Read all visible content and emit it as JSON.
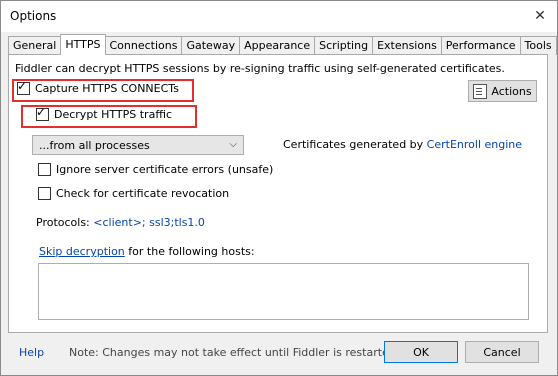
{
  "window": {
    "title": "Options",
    "close_glyph": "✕"
  },
  "tabs": [
    {
      "label": "General"
    },
    {
      "label": "HTTPS"
    },
    {
      "label": "Connections"
    },
    {
      "label": "Gateway"
    },
    {
      "label": "Appearance"
    },
    {
      "label": "Scripting"
    },
    {
      "label": "Extensions"
    },
    {
      "label": "Performance"
    },
    {
      "label": "Tools"
    }
  ],
  "https": {
    "intro": "Fiddler can decrypt HTTPS sessions by re-signing traffic using self-generated certificates.",
    "capture_label": "Capture HTTPS CONNECTs",
    "capture_checked": true,
    "decrypt_label": "Decrypt HTTPS traffic",
    "decrypt_checked": true,
    "actions_label": "Actions",
    "process_filter": "...from all processes",
    "cert_text": "Certificates generated by",
    "cert_engine": "CertEnroll engine",
    "ignore_errors_label": "Ignore server certificate errors (unsafe)",
    "ignore_errors_checked": false,
    "revocation_label": "Check for certificate revocation",
    "revocation_checked": false,
    "protocols_label": "Protocols:",
    "protocols_value": "<client>; ssl3;tls1.0",
    "skip_link": "Skip decryption",
    "skip_text": "for the following hosts:",
    "skip_hosts": ""
  },
  "footer": {
    "help": "Help",
    "note": "Note: Changes may not take effect until Fiddler is restarted.",
    "ok": "OK",
    "cancel": "Cancel"
  },
  "colors": {
    "highlight_box": "#e03030",
    "link": "#0645ad"
  }
}
